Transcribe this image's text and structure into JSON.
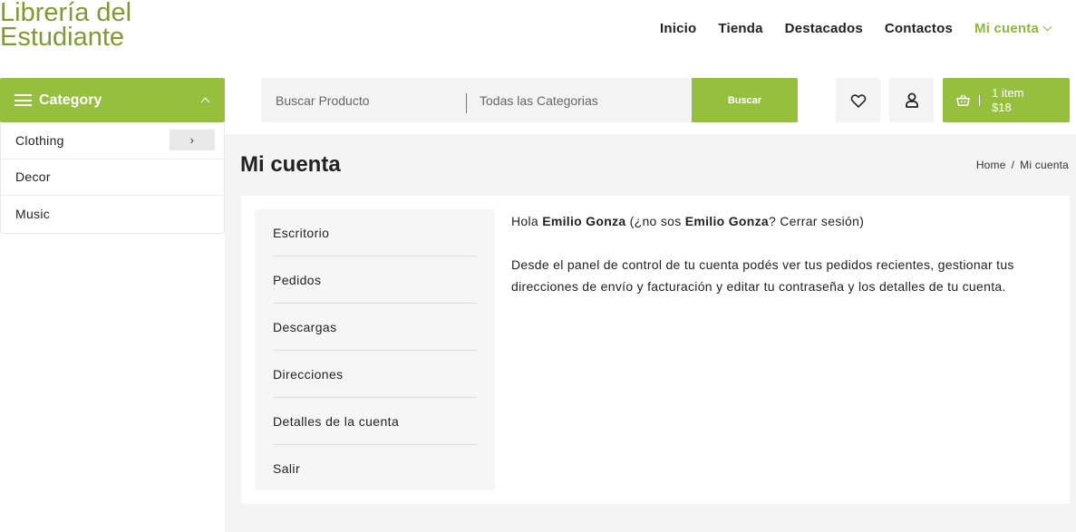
{
  "header": {
    "logo": "Librería del Estudiante",
    "nav": [
      {
        "label": "Inicio"
      },
      {
        "label": "Tienda"
      },
      {
        "label": "Destacados"
      },
      {
        "label": "Contactos"
      },
      {
        "label": "Mi cuenta",
        "active": true
      }
    ]
  },
  "category": {
    "title": "Category",
    "items": [
      {
        "label": "Clothing",
        "has_sub": true
      },
      {
        "label": "Decor"
      },
      {
        "label": "Music"
      }
    ],
    "sub_arrow": "›"
  },
  "search": {
    "placeholder": "Buscar Producto",
    "category_label": "Todas las Categorias",
    "button": "Buscar"
  },
  "cart": {
    "count": "1 item",
    "total": "$18"
  },
  "page": {
    "title": "Mi cuenta",
    "breadcrumb": [
      "Home",
      "/",
      "Mi cuenta"
    ]
  },
  "account_nav": [
    "Escritorio",
    "Pedidos",
    "Descargas",
    "Direcciones",
    "Detalles de la cuenta",
    "Salir"
  ],
  "dashboard": {
    "greeting_prefix": "Hola ",
    "user_name": "Emilio Gonza",
    "not_you_prefix": " (¿no sos ",
    "not_you_name": "Emilio Gonza",
    "not_you_suffix": "? Cerrar sesión)",
    "description": "Desde el panel de control de tu cuenta podés ver tus pedidos recientes, gestionar tus direcciones de envío y facturación y editar tu contraseña y los detalles de tu cuenta."
  },
  "colors": {
    "accent": "#95bf3d",
    "logo": "#7f9a33",
    "background_main": "#f4f4f4"
  },
  "icons": [
    "hamburger-icon",
    "chevron-up-icon",
    "chevron-right-icon",
    "chevron-down-icon",
    "heart-icon",
    "user-icon",
    "basket-icon"
  ]
}
